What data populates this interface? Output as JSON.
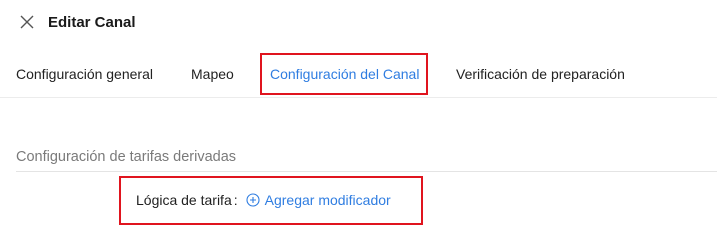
{
  "dialog": {
    "title": "Editar Canal",
    "close_icon": "close-icon"
  },
  "tabs": [
    {
      "label": "Configuración general",
      "active": false
    },
    {
      "label": "Mapeo",
      "active": false
    },
    {
      "label": "Configuración del Canal",
      "active": true
    },
    {
      "label": "Verificación de preparación",
      "active": false
    }
  ],
  "section": {
    "title": "Configuración de tarifas derivadas",
    "fields": [
      {
        "label": "Lógica de tarifa",
        "colon": ":",
        "action_label": "Agregar modificador",
        "action_icon": "plus-circle-icon"
      }
    ]
  },
  "colors": {
    "accent": "#2f7de1",
    "highlight": "#e0141e"
  }
}
